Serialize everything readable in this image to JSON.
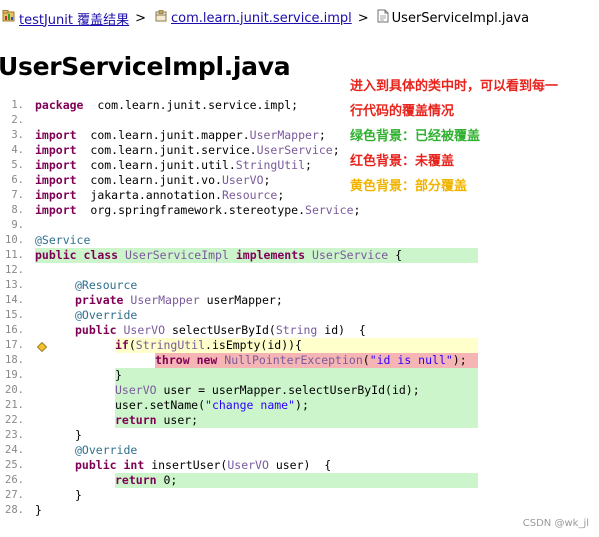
{
  "breadcrumb": {
    "items": [
      {
        "label": "testJunit 覆盖结果"
      },
      {
        "label": "com.learn.junit.service.impl"
      },
      {
        "label": "UserServiceImpl.java"
      }
    ],
    "separator": ">"
  },
  "page_title": "UserServiceImpl.java",
  "annotation": {
    "lines": [
      {
        "text": "进入到具体的类中时，可以看到每一",
        "color": "#e8231c"
      },
      {
        "text": "行代码的覆盖情况",
        "color": "#e8231c"
      },
      {
        "text": "绿色背景：已经被覆盖",
        "color": "#2fb12f"
      },
      {
        "text": "红色背景：未覆盖",
        "color": "#e8231c"
      },
      {
        "text": "黄色背景：部分覆盖",
        "color": "#f0b400"
      }
    ]
  },
  "colors": {
    "covered": "#ccf5cc",
    "not_covered": "#f5b5b5",
    "partial": "#ffffcc",
    "keyword": "#7f0055",
    "link": "#1a0dab"
  },
  "code_lines": [
    {
      "n": "1.",
      "status": "none",
      "indent": 0,
      "tokens": [
        [
          "kw",
          "package"
        ],
        [
          "",
          "  com.learn.junit.service.impl;"
        ]
      ]
    },
    {
      "n": "2.",
      "status": "none",
      "indent": 0,
      "tokens": []
    },
    {
      "n": "3.",
      "status": "none",
      "indent": 0,
      "tokens": [
        [
          "kw",
          "import"
        ],
        [
          "",
          "  com.learn.junit.mapper."
        ],
        [
          "ty",
          "UserMapper"
        ],
        [
          "",
          ";"
        ]
      ]
    },
    {
      "n": "4.",
      "status": "none",
      "indent": 0,
      "tokens": [
        [
          "kw",
          "import"
        ],
        [
          "",
          "  com.learn.junit.service."
        ],
        [
          "ty",
          "UserService"
        ],
        [
          "",
          ";"
        ]
      ]
    },
    {
      "n": "5.",
      "status": "none",
      "indent": 0,
      "tokens": [
        [
          "kw",
          "import"
        ],
        [
          "",
          "  com.learn.junit.util."
        ],
        [
          "ty",
          "StringUtil"
        ],
        [
          "",
          ";"
        ]
      ]
    },
    {
      "n": "6.",
      "status": "none",
      "indent": 0,
      "tokens": [
        [
          "kw",
          "import"
        ],
        [
          "",
          "  com.learn.junit.vo."
        ],
        [
          "ty",
          "UserVO"
        ],
        [
          "",
          ";"
        ]
      ]
    },
    {
      "n": "7.",
      "status": "none",
      "indent": 0,
      "tokens": [
        [
          "kw",
          "import"
        ],
        [
          "",
          "  jakarta.annotation."
        ],
        [
          "ty",
          "Resource"
        ],
        [
          "",
          ";"
        ]
      ]
    },
    {
      "n": "8.",
      "status": "none",
      "indent": 0,
      "tokens": [
        [
          "kw",
          "import"
        ],
        [
          "",
          "  org.springframework.stereotype."
        ],
        [
          "ty",
          "Service"
        ],
        [
          "",
          ";"
        ]
      ]
    },
    {
      "n": "9.",
      "status": "none",
      "indent": 0,
      "tokens": []
    },
    {
      "n": "10.",
      "status": "none",
      "indent": 0,
      "tokens": [
        [
          "an",
          "@Service"
        ]
      ]
    },
    {
      "n": "11.",
      "status": "covered",
      "indent": 0,
      "tokens": [
        [
          "kw",
          "public"
        ],
        [
          "",
          " "
        ],
        [
          "kw",
          "class"
        ],
        [
          "",
          " "
        ],
        [
          "ty",
          "UserServiceImpl"
        ],
        [
          "",
          " "
        ],
        [
          "kw",
          "implements"
        ],
        [
          "",
          " "
        ],
        [
          "ty",
          "UserService"
        ],
        [
          "",
          " {"
        ]
      ]
    },
    {
      "n": "12.",
      "status": "none",
      "indent": 0,
      "tokens": []
    },
    {
      "n": "13.",
      "status": "none",
      "indent": 1,
      "tokens": [
        [
          "an",
          "@Resource"
        ]
      ]
    },
    {
      "n": "14.",
      "status": "none",
      "indent": 1,
      "tokens": [
        [
          "kw",
          "private"
        ],
        [
          "",
          " "
        ],
        [
          "ty",
          "UserMapper"
        ],
        [
          "",
          " userMapper;"
        ]
      ]
    },
    {
      "n": "15.",
      "status": "none",
      "indent": 1,
      "tokens": [
        [
          "an",
          "@Override"
        ]
      ]
    },
    {
      "n": "16.",
      "status": "none",
      "indent": 1,
      "tokens": [
        [
          "kw",
          "public"
        ],
        [
          "",
          " "
        ],
        [
          "ty",
          "UserVO"
        ],
        [
          "",
          " selectUserById("
        ],
        [
          "ty",
          "String"
        ],
        [
          "",
          " id)  {"
        ]
      ]
    },
    {
      "n": "17.",
      "status": "partial",
      "indent": 2,
      "tokens": [
        [
          "kw",
          "if"
        ],
        [
          "",
          "("
        ],
        [
          "ty",
          "StringUtil"
        ],
        [
          "",
          ".isEmpty(id)){"
        ]
      ]
    },
    {
      "n": "18.",
      "status": "not_covered",
      "indent": 3,
      "tokens": [
        [
          "kw",
          "throw"
        ],
        [
          "",
          " "
        ],
        [
          "kw",
          "new"
        ],
        [
          "",
          " "
        ],
        [
          "ty",
          "NullPointerException"
        ],
        [
          "",
          "("
        ],
        [
          "st",
          "\"id is null\""
        ],
        [
          "",
          ");"
        ]
      ]
    },
    {
      "n": "19.",
      "status": "covered",
      "indent": 2,
      "tokens": [
        [
          "",
          "}"
        ]
      ]
    },
    {
      "n": "20.",
      "status": "covered",
      "indent": 2,
      "tokens": [
        [
          "ty",
          "UserVO"
        ],
        [
          "",
          " user = userMapper.selectUserById(id);"
        ]
      ]
    },
    {
      "n": "21.",
      "status": "covered",
      "indent": 2,
      "tokens": [
        [
          "",
          "user.setName("
        ],
        [
          "st",
          "\"change name\""
        ],
        [
          "",
          ");"
        ]
      ]
    },
    {
      "n": "22.",
      "status": "covered",
      "indent": 2,
      "tokens": [
        [
          "kw",
          "return"
        ],
        [
          "",
          " user;"
        ]
      ]
    },
    {
      "n": "23.",
      "status": "none",
      "indent": 1,
      "tokens": [
        [
          "",
          "}"
        ]
      ]
    },
    {
      "n": "24.",
      "status": "none",
      "indent": 1,
      "tokens": [
        [
          "an",
          "@Override"
        ]
      ]
    },
    {
      "n": "25.",
      "status": "none",
      "indent": 1,
      "tokens": [
        [
          "kw",
          "public"
        ],
        [
          "",
          " "
        ],
        [
          "kw",
          "int"
        ],
        [
          "",
          " insertUser("
        ],
        [
          "ty",
          "UserVO"
        ],
        [
          "",
          " user)  {"
        ]
      ]
    },
    {
      "n": "26.",
      "status": "covered",
      "indent": 2,
      "tokens": [
        [
          "kw",
          "return"
        ],
        [
          "",
          " 0;"
        ]
      ]
    },
    {
      "n": "27.",
      "status": "none",
      "indent": 1,
      "tokens": [
        [
          "",
          "}"
        ]
      ]
    },
    {
      "n": "28.",
      "status": "none",
      "indent": 0,
      "tokens": [
        [
          "",
          "}"
        ]
      ]
    }
  ],
  "watermark": "CSDN @wk_jl"
}
